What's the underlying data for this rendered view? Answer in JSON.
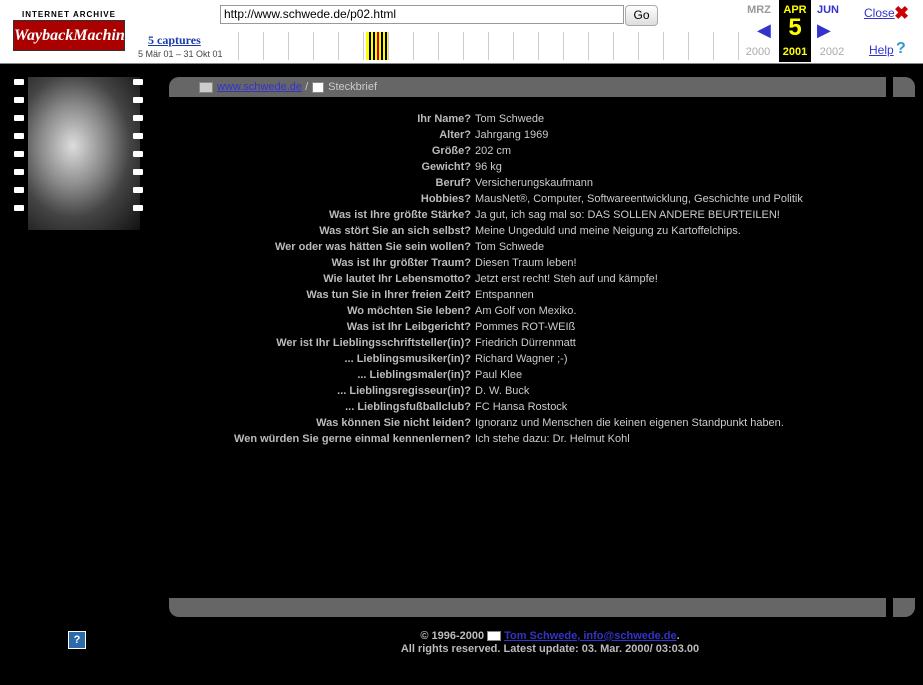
{
  "wayback": {
    "logo_top": "INTERNET ARCHIVE",
    "logo_bottom": "WaybackMachine",
    "url": "http://www.schwede.de/p02.html",
    "go_label": "Go",
    "captures": "5 captures",
    "range": "5 Mär 01 – 31 Okt 01",
    "prev_month": "MRZ",
    "cur_month": "APR",
    "next_month": "JUN",
    "cur_day": "5",
    "prev_year": "2000",
    "cur_year": "2001",
    "next_year": "2002",
    "close_label": "Close",
    "help_label": "Help",
    "icons": {
      "prev": "left-arrow-icon",
      "next": "right-arrow-icon",
      "close": "close-x-icon",
      "help": "question-icon"
    }
  },
  "breadcrumb": {
    "link": "www.schwede.de",
    "sep": "/",
    "current": "Steckbrief"
  },
  "profile": [
    {
      "q": "Ihr Name?",
      "a": "Tom Schwede"
    },
    {
      "q": "Alter?",
      "a": "Jahrgang 1969"
    },
    {
      "q": "Größe?",
      "a": "202 cm"
    },
    {
      "q": "Gewicht?",
      "a": "96 kg"
    },
    {
      "q": "Beruf?",
      "a": "Versicherungskaufmann"
    },
    {
      "q": "Hobbies?",
      "a": "MausNet®, Computer, Softwareentwicklung, Geschichte und Politik"
    },
    {
      "q": "Was ist Ihre größte Stärke?",
      "a": "Ja gut, ich sag mal so: DAS SOLLEN ANDERE BEURTEILEN!"
    },
    {
      "q": "Was stört Sie an sich selbst?",
      "a": "Meine Ungeduld und meine Neigung zu Kartoffelchips."
    },
    {
      "q": "Wer oder was hätten Sie sein wollen?",
      "a": "Tom Schwede"
    },
    {
      "q": "Was ist Ihr größter Traum?",
      "a": "Diesen Traum leben!"
    },
    {
      "q": "Wie lautet Ihr Lebensmotto?",
      "a": "Jetzt erst recht! Steh auf und kämpfe!"
    },
    {
      "q": "Was tun Sie in Ihrer freien Zeit?",
      "a": "Entspannen"
    },
    {
      "q": "Wo möchten Sie leben?",
      "a": "Am Golf von Mexiko."
    },
    {
      "q": "Was ist Ihr Leibgericht?",
      "a": "Pommes ROT-WEIß"
    },
    {
      "q": "Wer ist Ihr Lieblingsschriftsteller(in)?",
      "a": "Friedrich Dürrenmatt"
    },
    {
      "q": "... Lieblingsmusiker(in)?",
      "a": "Richard Wagner ;-)"
    },
    {
      "q": "... Lieblingsmaler(in)?",
      "a": "Paul Klee"
    },
    {
      "q": "... Lieblingsregisseur(in)?",
      "a": "D. W. Buck"
    },
    {
      "q": "... Lieblingsfußballclub?",
      "a": "FC Hansa Rostock"
    },
    {
      "q": "Was können Sie nicht leiden?",
      "a": "Ignoranz und Menschen die keinen eigenen Standpunkt haben."
    },
    {
      "q": "Wen würden Sie gerne einmal kennenlernen?",
      "a": "Ich stehe dazu: Dr. Helmut Kohl"
    }
  ],
  "footer": {
    "copyright": "© 1996-2000",
    "author_link": "Tom Schwede, info@schwede.de",
    "period": ".",
    "rights": "All rights reserved. Latest update: 03. Mar. 2000/ 03:03.00",
    "help_glyph": "?"
  }
}
